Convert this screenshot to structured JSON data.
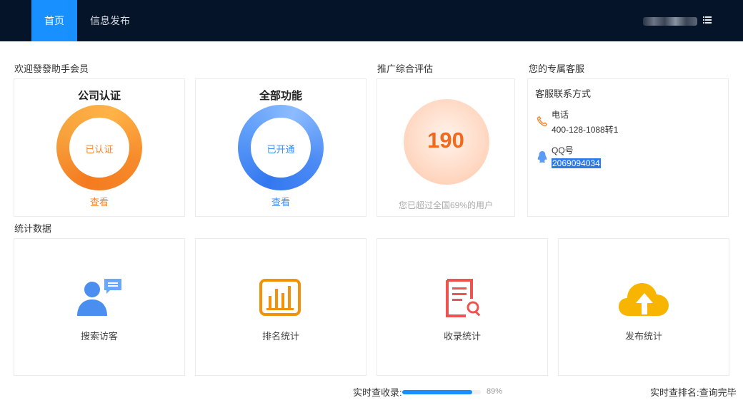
{
  "nav": {
    "items": [
      {
        "label": "首页",
        "active": true
      },
      {
        "label": "信息发布",
        "active": false
      }
    ],
    "menu_icon": "list-icon"
  },
  "welcome": {
    "title": "欢迎發發助手会员",
    "cards": [
      {
        "title": "公司认证",
        "status": "已认证",
        "link": "查看",
        "color": "#f5862f"
      },
      {
        "title": "全部功能",
        "status": "已开通",
        "link": "查看",
        "color": "#3d8bf7"
      }
    ]
  },
  "evaluation": {
    "title": "推广综合评估",
    "score": "190",
    "description": "您已超过全国69%的用户"
  },
  "service": {
    "title": "您的专属客服",
    "heading": "客服联系方式",
    "phone_label": "电话",
    "phone_value": "400-128-1088转1",
    "phone_icon": "phone-icon",
    "qq_label": "QQ号",
    "qq_value": "2069094034",
    "qq_icon": "qq-penguin-icon"
  },
  "stats": {
    "title": "统计数据",
    "items": [
      {
        "label": "搜索访客",
        "icon": "visitor-chat-icon",
        "color": "#4a8ff0"
      },
      {
        "label": "排名统计",
        "icon": "bar-chart-icon",
        "color": "#f2920a"
      },
      {
        "label": "收录统计",
        "icon": "document-search-icon",
        "color": "#ef5350"
      },
      {
        "label": "发布统计",
        "icon": "cloud-upload-icon",
        "color": "#f8b500"
      }
    ]
  },
  "footer": {
    "progress_label": "实时查收录:",
    "progress_percent": "89%",
    "progress_value": 0.89,
    "rank_status": "实时查排名:查询完毕"
  },
  "colors": {
    "topbar": "#051428",
    "accent": "#1890ff"
  }
}
